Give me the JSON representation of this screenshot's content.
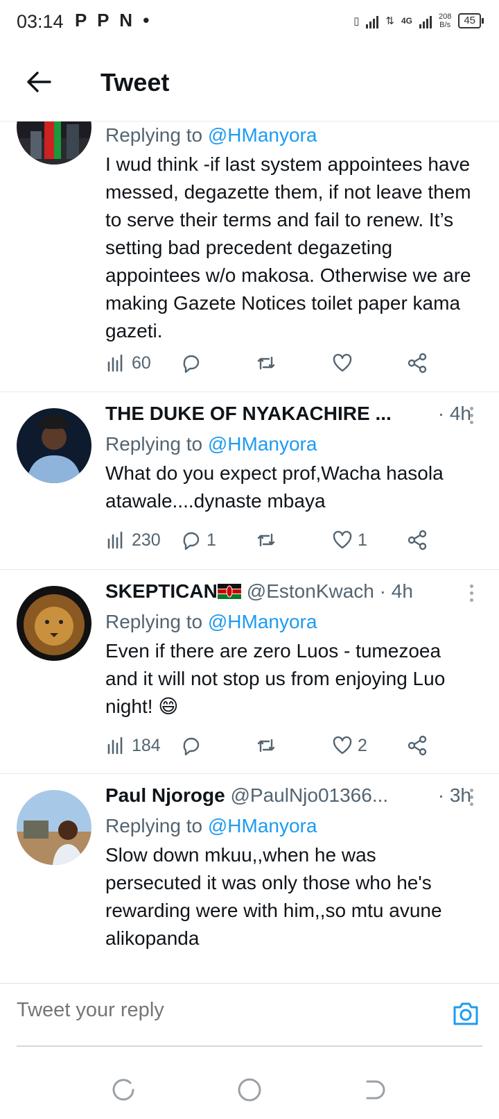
{
  "status_bar": {
    "time": "03:14",
    "left_icons": "P P N •",
    "network": "4G",
    "speed_value": "208",
    "speed_unit": "B/s",
    "battery": "45"
  },
  "header": {
    "title": "Tweet"
  },
  "tweets": [
    {
      "name": "",
      "handle": "",
      "time": "",
      "replying_prefix": "Replying to",
      "replying_to": "@HManyora",
      "text": "I wud think -if last system appointees have messed, degazette them, if not leave them to serve their terms and fail to renew. It’s setting bad precedent degazeting appointees w/o makosa. Otherwise we are making Gazete Notices toilet paper kama gazeti.",
      "views": "60",
      "replies": "",
      "retweets": "",
      "likes": ""
    },
    {
      "name": "THE DUKE OF NYAKACHIRE ...",
      "handle": "",
      "time": "· 4h",
      "replying_prefix": "Replying to",
      "replying_to": "@HManyora",
      "text": "What do you expect prof,Wacha hasola atawale....dynaste mbaya",
      "views": "230",
      "replies": "1",
      "retweets": "",
      "likes": "1"
    },
    {
      "name": "SKEPTICAN",
      "handle": "@EstonKwach",
      "time": "· 4h",
      "replying_prefix": "Replying to",
      "replying_to": "@HManyora",
      "text": "Even if there are zero Luos - tumezoea and it will not stop us from enjoying Luo night! 😄",
      "views": "184",
      "replies": "",
      "retweets": "",
      "likes": "2"
    },
    {
      "name": "Paul Njoroge",
      "handle": "@PaulNjo01366...",
      "time": "· 3h",
      "replying_prefix": "Replying to",
      "replying_to": "@HManyora",
      "text": "Slow down mkuu,,when he was persecuted it was only those who he's rewarding were with him,,so mtu avune alikopanda",
      "views": "",
      "replies": "",
      "retweets": "",
      "likes": ""
    }
  ],
  "compose": {
    "placeholder": "Tweet your reply"
  },
  "colors": {
    "accent": "#1d9bf0",
    "text": "#0f1419",
    "secondary": "#536471",
    "divider": "#e6ecf0"
  },
  "icons": [
    "back-arrow-icon",
    "views-icon",
    "reply-icon",
    "retweet-icon",
    "like-icon",
    "share-icon",
    "more-icon",
    "camera-icon",
    "kenya-flag-icon"
  ]
}
